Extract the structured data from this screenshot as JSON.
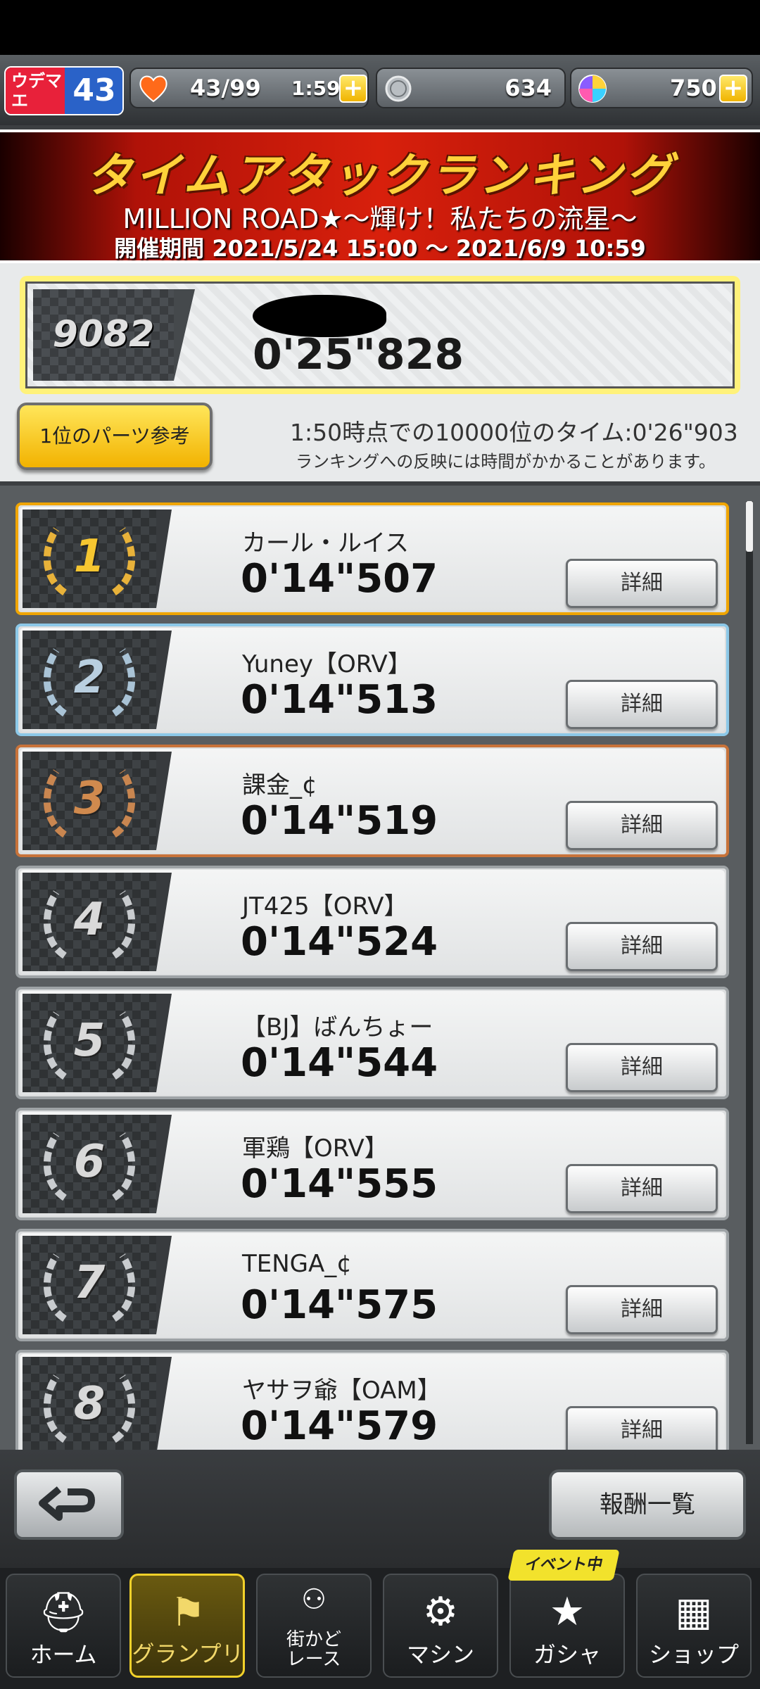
{
  "topbar": {
    "udemae_label": "ウデマエ",
    "udemae_level": "43",
    "stamina": "43/99",
    "stamina_timer": "1:59",
    "coins": "634",
    "gems": "750",
    "plus": "+"
  },
  "banner": {
    "title": "タイムアタックランキング",
    "subtitle": "MILLION ROAD★〜輝け！私たちの流星〜",
    "period": "開催期間 2021/5/24 15:00 〜 2021/6/9 10:59"
  },
  "my_rank": {
    "rank": "9082",
    "time": "0'25\"828"
  },
  "parts_button": "1位のパーツ参考",
  "note_line1": "1:50時点での10000位のタイム:0'26\"903",
  "note_line2": "ランキングへの反映には時間がかかることがあります。",
  "rows": [
    {
      "rank": "1",
      "name": "カール・ルイス",
      "time": "0'14\"507",
      "detail": "詳細"
    },
    {
      "rank": "2",
      "name": "Yuney【ORV】",
      "time": "0'14\"513",
      "detail": "詳細"
    },
    {
      "rank": "3",
      "name": "課金_¢",
      "time": "0'14\"519",
      "detail": "詳細"
    },
    {
      "rank": "4",
      "name": "JT425【ORV】",
      "time": "0'14\"524",
      "detail": "詳細"
    },
    {
      "rank": "5",
      "name": "【BJ】ばんちょー",
      "time": "0'14\"544",
      "detail": "詳細"
    },
    {
      "rank": "6",
      "name": "軍鶏【ORV】",
      "time": "0'14\"555",
      "detail": "詳細"
    },
    {
      "rank": "7",
      "name": "TENGA_¢",
      "time": "0'14\"575",
      "detail": "詳細"
    },
    {
      "rank": "8",
      "name": "ヤサヲ爺【OAM】",
      "time": "0'14\"579",
      "detail": "詳細"
    }
  ],
  "bottom": {
    "reward_button": "報酬一覧"
  },
  "nav": {
    "event_tag": "イベント中",
    "items": [
      {
        "label": "ホーム",
        "icon": "toolbox-icon"
      },
      {
        "label": "グランプリ",
        "icon": "checkered-flag-icon"
      },
      {
        "label": "街かど\nレース",
        "icon": "street-race-icon"
      },
      {
        "label": "マシン",
        "icon": "car-icon"
      },
      {
        "label": "ガシャ",
        "icon": "star-laurel-icon"
      },
      {
        "label": "ショップ",
        "icon": "shop-icon"
      }
    ]
  }
}
